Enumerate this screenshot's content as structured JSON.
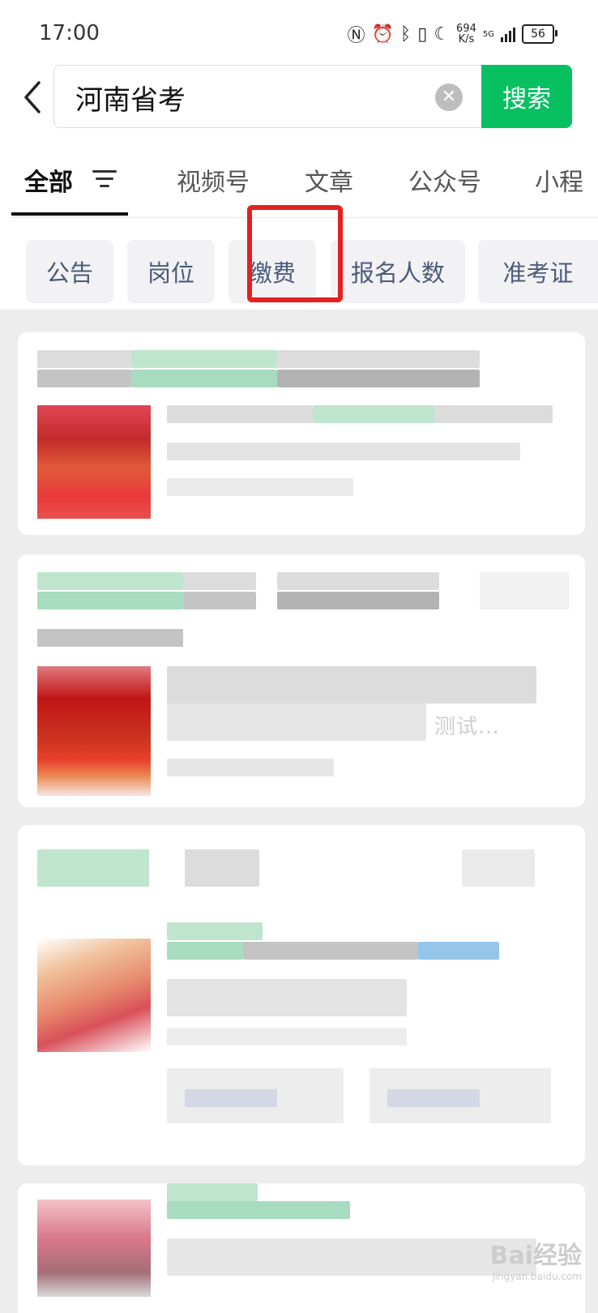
{
  "status_bar": {
    "time": "17:00",
    "net_speed_value": "694",
    "net_speed_unit": "K/s",
    "signal_label": "5G",
    "battery": "56"
  },
  "search": {
    "query": "河南省考",
    "button_label": "搜索"
  },
  "tabs": [
    {
      "label": "全部"
    },
    {
      "label": "视频号"
    },
    {
      "label": "文章"
    },
    {
      "label": "公众号"
    },
    {
      "label": "小程"
    }
  ],
  "chips": [
    {
      "label": "公告"
    },
    {
      "label": "岗位"
    },
    {
      "label": "缴费"
    },
    {
      "label": "报名人数"
    },
    {
      "label": "准考证"
    }
  ],
  "highlighted_chip": "缴费",
  "results": {
    "card2_visible_fragment": "测试…"
  },
  "watermark": {
    "brand": "Bai经验",
    "url": "jingyan.baidu.com"
  },
  "colors": {
    "accent_green": "#07c160",
    "highlight_red": "#e52020",
    "chip_text": "#4a5b7a"
  }
}
